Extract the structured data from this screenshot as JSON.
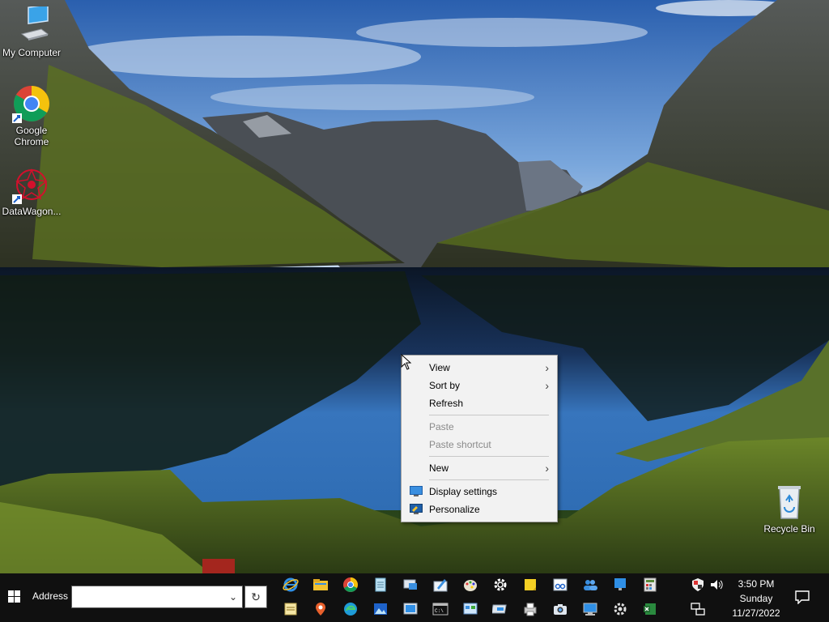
{
  "desktop": {
    "icons": [
      {
        "label": "My Computer",
        "icon": "computer-icon"
      },
      {
        "label": "Google Chrome",
        "icon": "chrome-icon"
      },
      {
        "label": "DataWagon...",
        "icon": "datawagon-icon"
      },
      {
        "label": "Recycle Bin",
        "icon": "recycle-bin-icon"
      }
    ]
  },
  "context_menu": {
    "items": [
      {
        "label": "View",
        "submenu": true,
        "disabled": false
      },
      {
        "label": "Sort by",
        "submenu": true,
        "disabled": false
      },
      {
        "label": "Refresh",
        "submenu": false,
        "disabled": false
      },
      {
        "label": "Paste",
        "submenu": false,
        "disabled": true
      },
      {
        "label": "Paste shortcut",
        "submenu": false,
        "disabled": true
      },
      {
        "label": "New",
        "submenu": true,
        "disabled": false
      },
      {
        "label": "Display settings",
        "submenu": false,
        "disabled": false,
        "icon": "display-settings-icon"
      },
      {
        "label": "Personalize",
        "submenu": false,
        "disabled": false,
        "icon": "personalize-icon"
      }
    ],
    "arrow_glyph": "›"
  },
  "taskbar": {
    "address_label": "Address",
    "address_value": "",
    "address_dropdown_glyph": "⌄",
    "address_go_glyph": "↻",
    "quick_launch_top": [
      "internet-explorer-icon",
      "file-explorer-icon",
      "chrome-icon",
      "notepad-icon",
      "remote-desktop-icon",
      "paint-icon",
      "paint-palette-icon",
      "settings-icon",
      "sticky-notes-icon",
      "snipping-tool-icon",
      "people-icon",
      "display-icon",
      "calculator-icon"
    ],
    "quick_launch_bottom": [
      "wordpad-icon",
      "maps-icon",
      "edge-icon",
      "photos-icon",
      "image-viewer-icon",
      "command-prompt-icon",
      "control-panel-icon",
      "devices-icon",
      "printers-icon",
      "camera-icon",
      "network-icon",
      "gear-icon",
      "excel-icon"
    ],
    "tray": {
      "time": "3:50 PM",
      "day": "Sunday",
      "date": "11/27/2022"
    }
  }
}
